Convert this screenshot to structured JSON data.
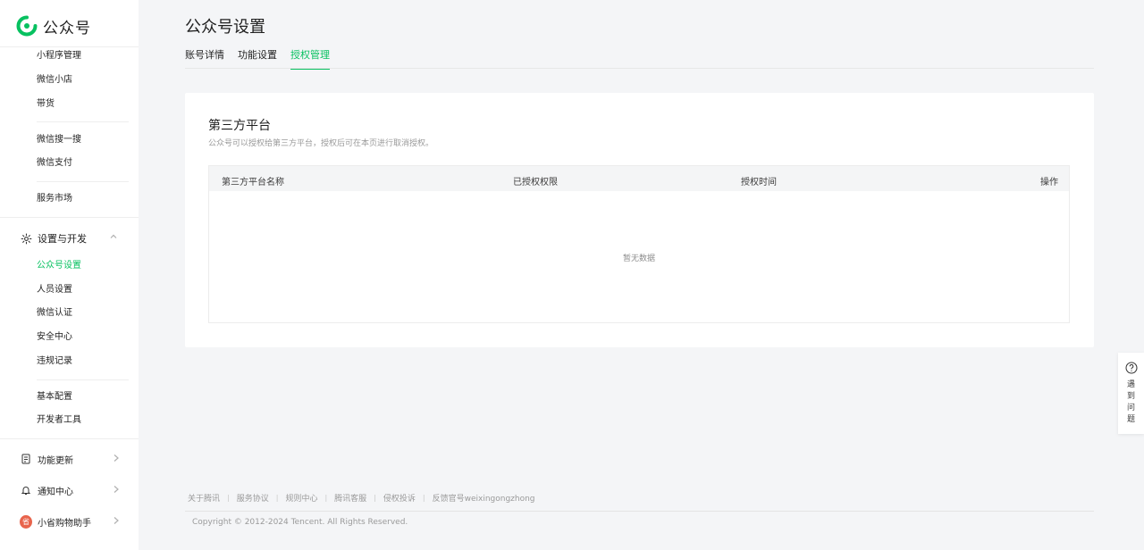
{
  "app": {
    "name": "公众号"
  },
  "sidebar": {
    "group1": [
      "小程序管理",
      "微信小店",
      "带货"
    ],
    "group2": [
      "微信搜一搜",
      "微信支付"
    ],
    "group3": [
      "服务市场"
    ],
    "settings_group": {
      "label": "设置与开发",
      "items": [
        "公众号设置",
        "人员设置",
        "微信认证",
        "安全中心",
        "违规记录"
      ],
      "active": "公众号设置"
    },
    "group4": [
      "基本配置",
      "开发者工具"
    ],
    "bottom": [
      {
        "label": "功能更新",
        "icon": "update-icon"
      },
      {
        "label": "通知中心",
        "icon": "bell-icon"
      },
      {
        "label": "小省购物助手",
        "icon": "avatar",
        "avatar_text": "省"
      }
    ]
  },
  "page": {
    "title": "公众号设置",
    "tabs": [
      "账号详情",
      "功能设置",
      "授权管理"
    ],
    "active_tab": "授权管理"
  },
  "card": {
    "title": "第三方平台",
    "description": "公众号可以授权给第三方平台，授权后可在本页进行取消授权。",
    "table": {
      "columns": [
        "第三方平台名称",
        "已授权权限",
        "授权时间",
        "操作"
      ],
      "empty_text": "暂无数据"
    }
  },
  "help": {
    "text": "遇到问题"
  },
  "footer": {
    "links": [
      "关于腾讯",
      "服务协议",
      "规则中心",
      "腾讯客服",
      "侵权投诉",
      "反馈官号weixingongzhong"
    ],
    "copyright": "Copyright © 2012-2024 Tencent. All Rights Reserved."
  },
  "colors": {
    "accent": "#07c160",
    "background": "#f4f5f7"
  }
}
